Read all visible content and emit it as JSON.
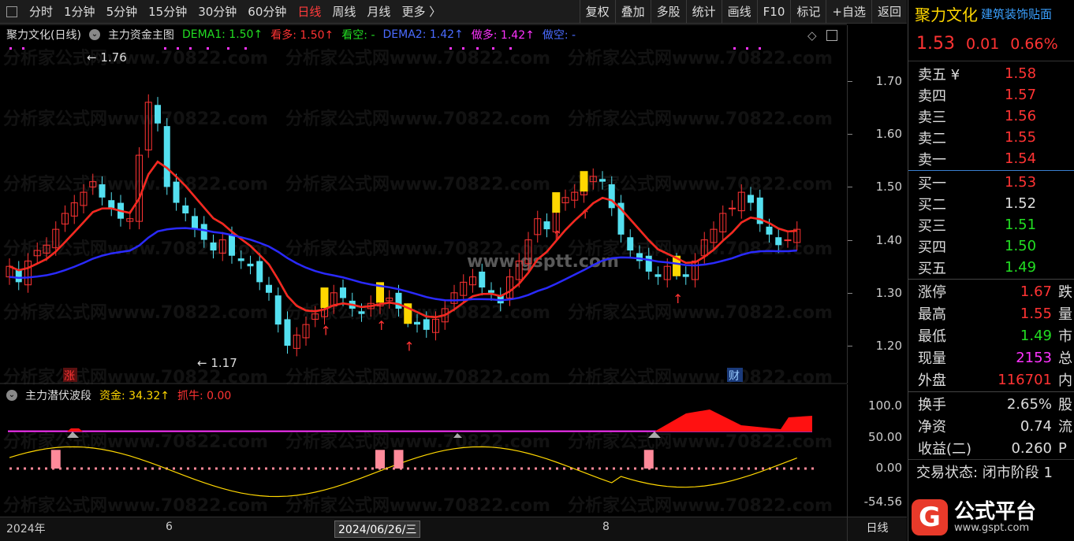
{
  "toolbar": {
    "periods": [
      "分时",
      "1分钟",
      "5分钟",
      "15分钟",
      "30分钟",
      "60分钟",
      "日线",
      "周线",
      "月线",
      "更多 〉"
    ],
    "active_period": "日线",
    "tools": [
      "复权",
      "叠加",
      "多股",
      "统计",
      "画线",
      "F10",
      "标记",
      "+自选",
      "返回"
    ]
  },
  "main_header": {
    "stock_period": "聚力文化(日线)",
    "indicator": "主力资金主图",
    "dema1": "DEMA1: 1.50↑",
    "kanduo": "看多: 1.50↑",
    "kankong": "看空: -",
    "dema2": "DEMA2: 1.42↑",
    "zuoduo": "做多: 1.42↑",
    "zuokong": "做空: -"
  },
  "price_axis": [
    "1.70",
    "1.60",
    "1.50",
    "1.40",
    "1.30",
    "1.20"
  ],
  "annotations": {
    "high": "1.76",
    "low": "1.17",
    "zhang": "涨",
    "cai": "财"
  },
  "indicator_header": {
    "name": "主力潜伏波段",
    "zijin": "资金: 34.32↑",
    "zhuaniu": "抓牛: 0.00"
  },
  "indicator_axis": [
    "100.0",
    "50.00",
    "0.00",
    "-54.56"
  ],
  "date_bar": {
    "d1": "2024年",
    "d2": "6",
    "d3": "2024/06/26/三",
    "d4": "8",
    "period": "日线"
  },
  "watermark": "分析家公式网www.70822.com",
  "watermark2": "www.gsptt.com",
  "colors": {
    "up": "#ff3333",
    "down": "#54e0f0",
    "signal": "#ffd700",
    "dema_up": "#ff2222",
    "dema_down": "#22dd22",
    "dema2_up": "#ff33ff",
    "dema2_down": "#2a2aff"
  },
  "panel": {
    "name": "聚力文化",
    "sector": "建筑装饰贴面",
    "price": "1.53",
    "change": "0.01",
    "pct": "0.66%",
    "sells": [
      {
        "label": "卖五 ¥",
        "price": "1.58"
      },
      {
        "label": "卖四",
        "price": "1.57"
      },
      {
        "label": "卖三",
        "price": "1.56"
      },
      {
        "label": "卖二",
        "price": "1.55"
      },
      {
        "label": "卖一",
        "price": "1.54"
      }
    ],
    "buys": [
      {
        "label": "买一",
        "price": "1.53",
        "color": "#ff3333"
      },
      {
        "label": "买二",
        "price": "1.52",
        "color": "#dddddd"
      },
      {
        "label": "买三",
        "price": "1.51",
        "color": "#22dd22"
      },
      {
        "label": "买四",
        "price": "1.50",
        "color": "#22dd22"
      },
      {
        "label": "买五",
        "price": "1.49",
        "color": "#22dd22"
      }
    ],
    "stats1": [
      {
        "label": "涨停",
        "value": "1.67",
        "color": "#ff3333",
        "tail": "跌"
      },
      {
        "label": "最高",
        "value": "1.55",
        "color": "#ff3333",
        "tail": "量"
      },
      {
        "label": "最低",
        "value": "1.49",
        "color": "#22dd22",
        "tail": "市"
      },
      {
        "label": "现量",
        "value": "2153",
        "color": "#ff33ff",
        "tail": "总"
      },
      {
        "label": "外盘",
        "value": "116701",
        "color": "#ff3333",
        "tail": "内"
      }
    ],
    "stats2": [
      {
        "label": "换手",
        "value": "2.65%",
        "color": "#dddddd",
        "tail": "股"
      },
      {
        "label": "净资",
        "value": "0.74",
        "color": "#dddddd",
        "tail": "流"
      },
      {
        "label": "收益(二)",
        "value": "0.260",
        "color": "#dddddd",
        "tail": "P"
      }
    ],
    "trade_state": "交易状态: 闭市阶段 1",
    "logo_name": "公式平台",
    "logo_url": "www.gspt.com"
  }
}
